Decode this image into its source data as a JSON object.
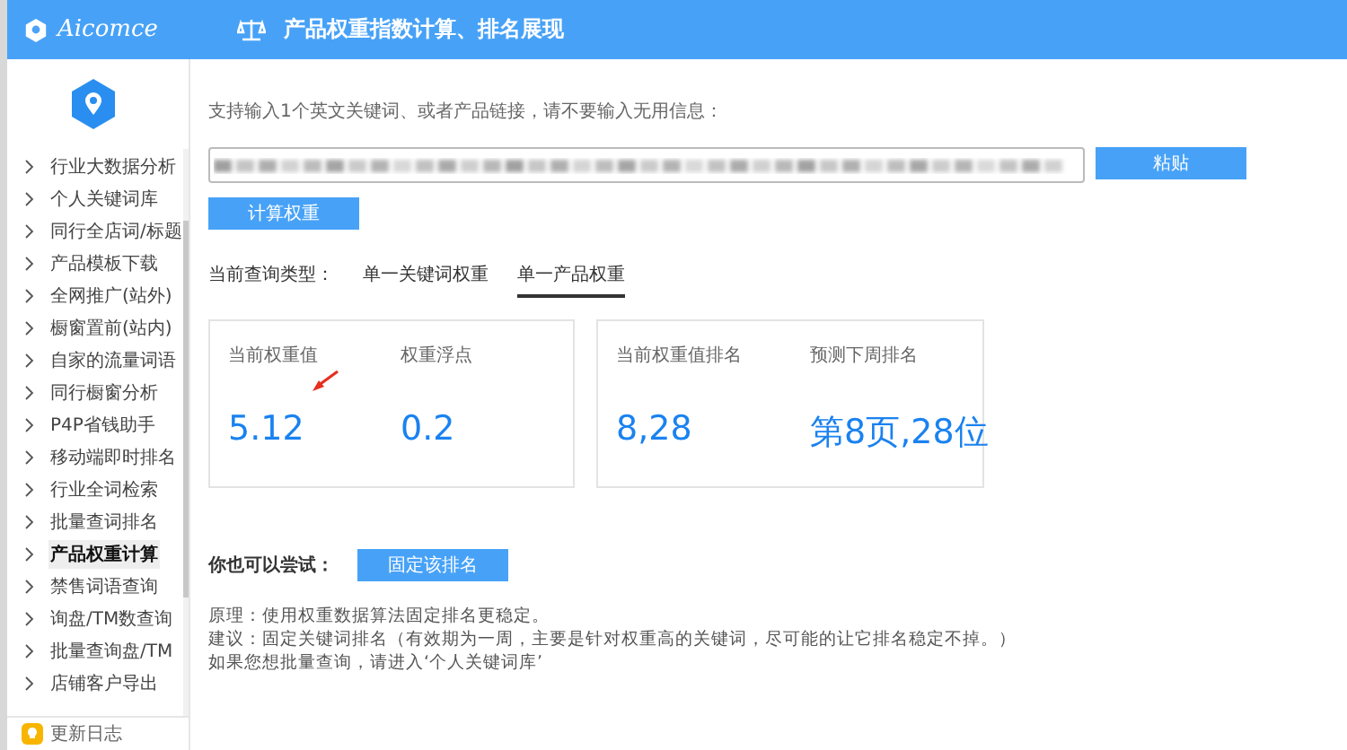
{
  "header": {
    "brand": "Aicomce",
    "title": "产品权重指数计算、排名展现"
  },
  "sidebar": {
    "items": [
      {
        "label": "行业大数据分析",
        "selected": false
      },
      {
        "label": "个人关键词库",
        "selected": false
      },
      {
        "label": "同行全店词/标题",
        "selected": false
      },
      {
        "label": "产品模板下载",
        "selected": false
      },
      {
        "label": "全网推广(站外)",
        "selected": false
      },
      {
        "label": "橱窗置前(站内)",
        "selected": false
      },
      {
        "label": "自家的流量词语",
        "selected": false
      },
      {
        "label": "同行橱窗分析",
        "selected": false
      },
      {
        "label": "P4P省钱助手",
        "selected": false
      },
      {
        "label": "移动端即时排名",
        "selected": false
      },
      {
        "label": "行业全词检索",
        "selected": false
      },
      {
        "label": "批量查词排名",
        "selected": false
      },
      {
        "label": "产品权重计算",
        "selected": true
      },
      {
        "label": "禁售词语查询",
        "selected": false
      },
      {
        "label": "询盘/TM数查询",
        "selected": false
      },
      {
        "label": "批量查询盘/TM",
        "selected": false
      },
      {
        "label": "店铺客户导出",
        "selected": false
      }
    ],
    "footer": "更新日志"
  },
  "main": {
    "hint": "支持输入1个英文关键词、或者产品链接，请不要输入无用信息：",
    "paste_button": "粘贴",
    "calc_button": "计算权重",
    "query_type_label": "当前查询类型：",
    "query_types": [
      {
        "label": "单一关键词权重",
        "selected": false
      },
      {
        "label": "单一产品权重",
        "selected": true
      }
    ],
    "cards": [
      {
        "stats": [
          {
            "label": "当前权重值",
            "value": "5.12"
          },
          {
            "label": "权重浮点",
            "value": "0.2"
          }
        ]
      },
      {
        "stats": [
          {
            "label": "当前权重值排名",
            "value": "8,28"
          },
          {
            "label": "预测下周排名",
            "value": "第8页,28位"
          }
        ]
      }
    ],
    "try_label": "你也可以尝试：",
    "fix_button": "固定该排名",
    "notes": [
      "原理：使用权重数据算法固定排名更稳定。",
      "建议：固定关键词排名（有效期为一周，主要是针对权重高的关键词，尽可能的让它排名稳定不掉。）",
      "如果您想批量查询，请进入‘个人关键词库’"
    ]
  }
}
